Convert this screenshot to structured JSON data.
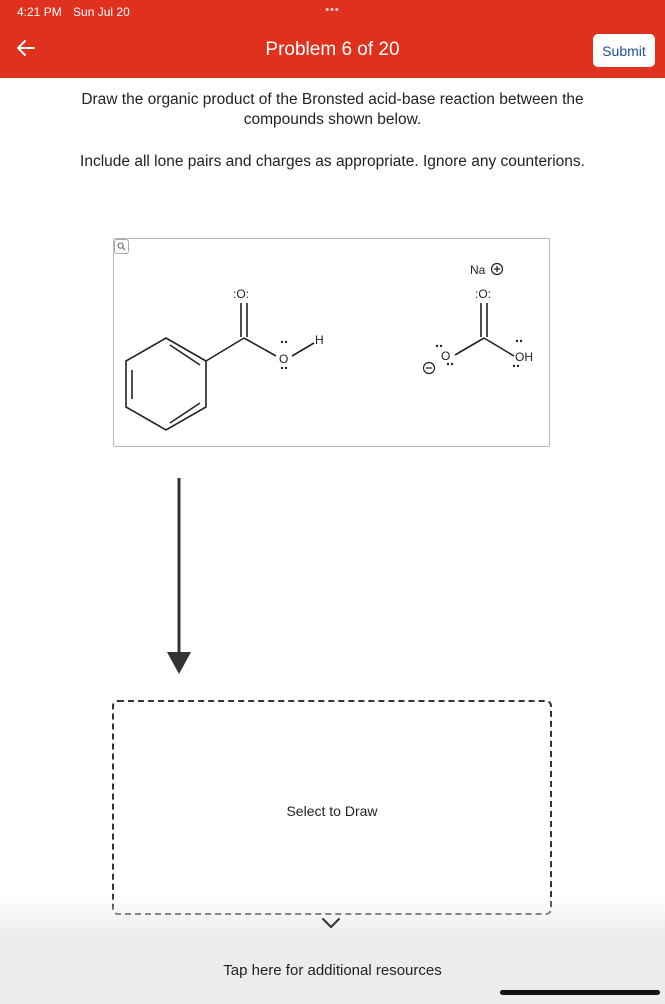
{
  "status_bar": {
    "time": "4:21 PM",
    "date": "Sun Jul 20"
  },
  "header": {
    "title": "Problem 6 of 20",
    "submit_label": "Submit",
    "back_icon": "arrow-left-icon",
    "more_icon": "more-dots-icon"
  },
  "instructions": {
    "line1": "Draw the organic product of the Bronsted acid-base reaction between the compounds shown below.",
    "line2": "Include all lone pairs and charges as appropriate. Ignore any counterions."
  },
  "reactants": {
    "sodium_label": "Na",
    "acid_carbonyl_o": ":O:",
    "acid_oh_o": "O",
    "acid_h": "H",
    "base_carbonyl_o": ":O:",
    "base_o_minus": "O",
    "base_oh": "OH",
    "zoom_icon": "magnifier-icon"
  },
  "draw_area": {
    "label": "Select to Draw"
  },
  "resources": {
    "label": "Tap here for additional resources",
    "chevron_icon": "chevron-down-icon"
  },
  "colors": {
    "header": "#e0311f",
    "submit_text": "#1f4fa0",
    "resources_bg": "#ececec"
  }
}
